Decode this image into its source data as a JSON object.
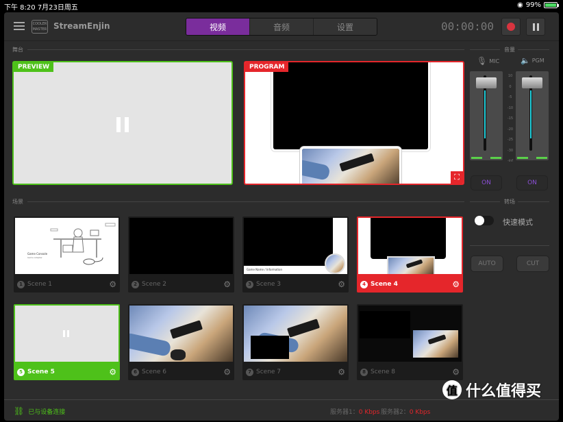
{
  "status_bar": {
    "time": "下午 8:20   7月23日周五",
    "battery": "99%",
    "battery_level": 0.99
  },
  "header": {
    "app_title": "StreamEnjin",
    "logo_text": "COOLER MASTER",
    "tabs": [
      {
        "label": "视频",
        "active": true
      },
      {
        "label": "音频",
        "active": false
      },
      {
        "label": "设置",
        "active": false
      }
    ],
    "timer": "00:00:00"
  },
  "stage": {
    "label": "舞台",
    "preview_tag": "PREVIEW",
    "program_tag": "PROGRAM"
  },
  "audio": {
    "label": "音量",
    "mic_label": "MIC",
    "pgm_label": "PGM",
    "scale": [
      "10",
      "0",
      "-5",
      "-10",
      "-15",
      "-20",
      "-25",
      "-30",
      "-inf"
    ],
    "mic_toggle": "ON",
    "pgm_toggle": "ON"
  },
  "scenes_section": {
    "label": "场景"
  },
  "scenes": [
    {
      "number": "1",
      "name": "Scene 1"
    },
    {
      "number": "2",
      "name": "Scene 2"
    },
    {
      "number": "3",
      "name": "Scene 3"
    },
    {
      "number": "4",
      "name": "Scene 4",
      "state": "program"
    },
    {
      "number": "5",
      "name": "Scene 5",
      "state": "preview"
    },
    {
      "number": "6",
      "name": "Scene 6"
    },
    {
      "number": "7",
      "name": "Scene 7"
    },
    {
      "number": "8",
      "name": "Scene 8"
    }
  ],
  "scene1_texts": {
    "line1": "Game Console",
    "line2": "Game Adapter"
  },
  "scene3_text": "Game Name / Information",
  "transition": {
    "label": "转场",
    "quick_mode_label": "快速模式",
    "quick_mode_on": false,
    "auto_label": "AUTO",
    "cut_label": "CUT"
  },
  "footer": {
    "connection": "已与设备连接",
    "server1_label": "服务器1：",
    "server1_value": "0 Kbps",
    "server2_label": "服务器2：",
    "server2_value": "0 Kbps"
  },
  "watermark": {
    "text": "什么值得买",
    "glyph": "值"
  },
  "colors": {
    "accent": "#7a2d9c",
    "preview": "#4ec11a",
    "program": "#e5262b",
    "meter": "#22d0dc"
  }
}
